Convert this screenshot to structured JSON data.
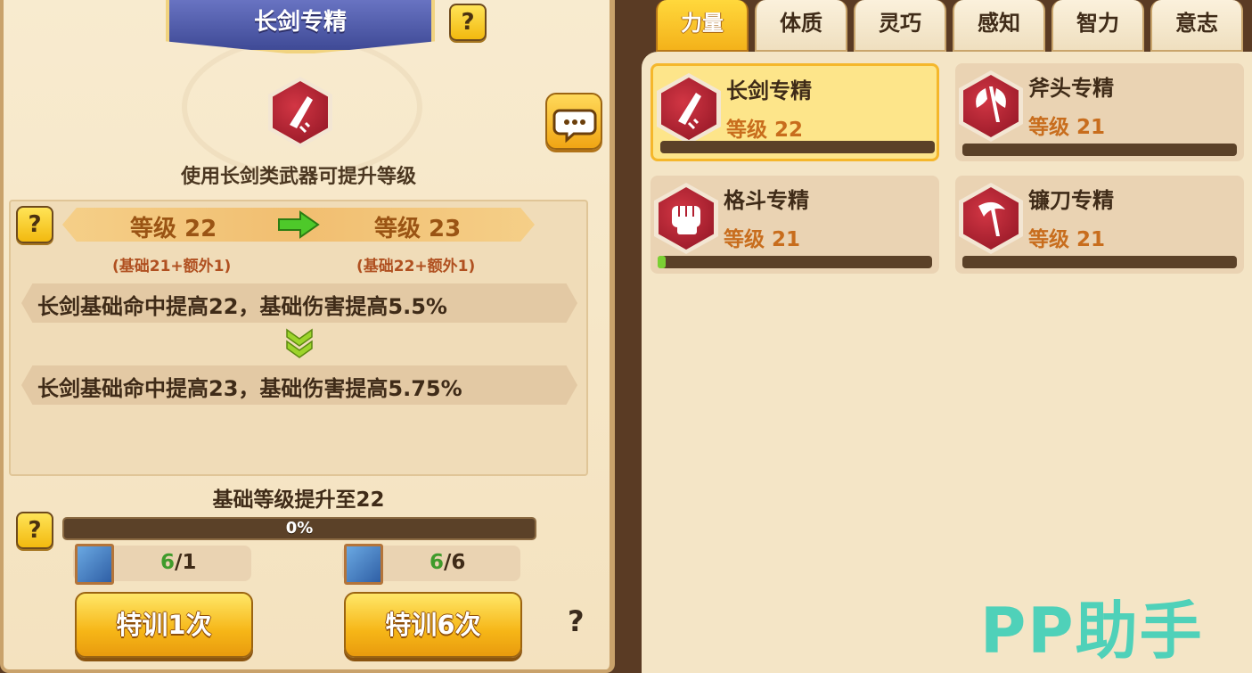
{
  "left_panel": {
    "title": "长剑专精",
    "description": "使用长剑类武器可提升等级",
    "current_level": "等级 22",
    "current_level_detail": "(基础21+额外1)",
    "next_level": "等级 23",
    "next_level_detail": "(基础22+额外1)",
    "effect_current": "长剑基础命中提高22，基础伤害提高5.5%",
    "effect_next": "长剑基础命中提高23，基础伤害提高5.75%",
    "base_upgrade_text": "基础等级提升至22",
    "progress_label": "0%",
    "progress_value": 0,
    "cost1": {
      "have": "6",
      "sep": "/",
      "need": "1"
    },
    "cost2": {
      "have": "6",
      "sep": "/",
      "need": "6"
    },
    "train_once_label": "特训1次",
    "train_six_label": "特训6次",
    "help_glyph": "?"
  },
  "tabs": [
    "力量",
    "体质",
    "灵巧",
    "感知",
    "智力",
    "意志"
  ],
  "active_tab": 0,
  "skills": [
    {
      "name": "长剑专精",
      "level": "等级 22",
      "icon": "sword-icon",
      "progress": 0.0,
      "selected": true
    },
    {
      "name": "斧头专精",
      "level": "等级 21",
      "icon": "axe-icon",
      "progress": 0.0,
      "selected": false
    },
    {
      "name": "格斗专精",
      "level": "等级 21",
      "icon": "fist-icon",
      "progress": 0.02,
      "selected": false
    },
    {
      "name": "镰刀专精",
      "level": "等级 21",
      "icon": "scythe-icon",
      "progress": 0.0,
      "selected": false
    }
  ],
  "watermark": "PP助手",
  "colors": {
    "accent": "#f4b21a",
    "progress_fill": "#7bd033",
    "skill_red": "#b21e2f"
  }
}
